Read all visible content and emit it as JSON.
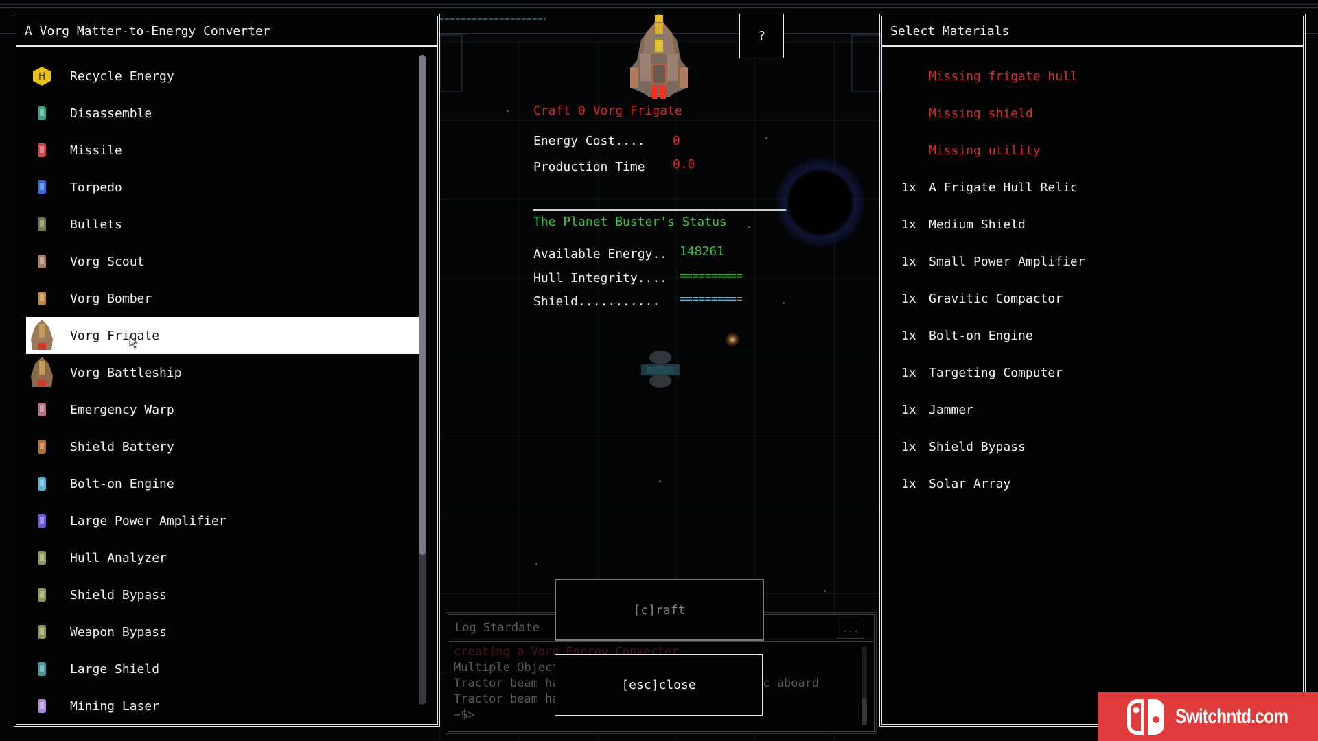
{
  "converter": {
    "title": "A Vorg Matter-to-Energy Converter",
    "items": [
      {
        "label": "Recycle Energy",
        "icon": "recycle-energy-icon",
        "color": "#e8c21a"
      },
      {
        "label": "Disassemble",
        "icon": "disassemble-icon",
        "color": "#3aa38a"
      },
      {
        "label": "Missile",
        "icon": "missile-icon",
        "color": "#c84a4a"
      },
      {
        "label": "Torpedo",
        "icon": "torpedo-icon",
        "color": "#3a6ad8"
      },
      {
        "label": "Bullets",
        "icon": "bullets-icon",
        "color": "#6f7a4a"
      },
      {
        "label": "Vorg Scout",
        "icon": "vorg-scout-icon",
        "color": "#a08060"
      },
      {
        "label": "Vorg Bomber",
        "icon": "vorg-bomber-icon",
        "color": "#b58a3a"
      },
      {
        "label": "Vorg Frigate",
        "icon": "vorg-frigate-icon",
        "color": "#9a7a5a",
        "selected": true
      },
      {
        "label": "Vorg Battleship",
        "icon": "vorg-battleship-icon",
        "color": "#8a6a4a"
      },
      {
        "label": "Emergency Warp",
        "icon": "emergency-warp-icon",
        "color": "#b07080"
      },
      {
        "label": "Shield Battery",
        "icon": "shield-battery-icon",
        "color": "#b0703a"
      },
      {
        "label": "Bolt-on Engine",
        "icon": "bolt-on-engine-icon",
        "color": "#5ab0d0"
      },
      {
        "label": "Large Power Amplifier",
        "icon": "large-power-amplifier-icon",
        "color": "#6a5ad8"
      },
      {
        "label": "Hull Analyzer",
        "icon": "hull-analyzer-icon",
        "color": "#8a9a5a"
      },
      {
        "label": "Shield Bypass",
        "icon": "shield-bypass-icon",
        "color": "#8a9a5a"
      },
      {
        "label": "Weapon Bypass",
        "icon": "weapon-bypass-icon",
        "color": "#8a9a5a"
      },
      {
        "label": "Large Shield",
        "icon": "large-shield-icon",
        "color": "#4a9a9a"
      },
      {
        "label": "Mining Laser",
        "icon": "mining-laser-icon",
        "color": "#b08ad0"
      }
    ],
    "scroll_fraction_visible": 0.77,
    "scroll_position": 0
  },
  "help_button": {
    "label": "?"
  },
  "craft": {
    "title": "Craft 0 Vorg Frigate",
    "energy_cost_label": "Energy Cost....",
    "energy_cost_value": "0",
    "production_time_label": "Production Time",
    "production_time_value": "0.0"
  },
  "status": {
    "title": "The Planet Buster's Status",
    "available_energy_label": "Available Energy..",
    "available_energy_value": "148261",
    "hull_label": "Hull Integrity....",
    "hull_segments": 10,
    "hull_filled": 10,
    "shield_label": "Shield...........",
    "shield_segments": 10,
    "shield_filled": 9
  },
  "buttons": {
    "craft": "[c]raft",
    "close": "[esc]close"
  },
  "log": {
    "title": "Log Stardate",
    "more": "...",
    "lines": [
      {
        "text": "creating a Vorg Energy Converter",
        "type": "error"
      },
      {
        "text": "Multiple Objects Detected",
        "type": "normal"
      },
      {
        "text": "Tractor beam has brought A Frigate Hull Relic aboard",
        "type": "normal"
      },
      {
        "text": "Tractor beam has brought Uranium aboard",
        "type": "normal"
      },
      {
        "text": "~$>",
        "type": "prompt"
      }
    ]
  },
  "materials": {
    "title": "Select Materials",
    "missing": [
      "Missing frigate hull",
      "Missing shield",
      "Missing utility"
    ],
    "items": [
      {
        "qty": "1x",
        "name": "A Frigate Hull Relic"
      },
      {
        "qty": "1x",
        "name": "Medium Shield"
      },
      {
        "qty": "1x",
        "name": "Small Power Amplifier"
      },
      {
        "qty": "1x",
        "name": "Gravitic Compactor"
      },
      {
        "qty": "1x",
        "name": "Bolt-on Engine"
      },
      {
        "qty": "1x",
        "name": "Targeting Computer"
      },
      {
        "qty": "1x",
        "name": "Jammer"
      },
      {
        "qty": "1x",
        "name": "Shield Bypass"
      },
      {
        "qty": "1x",
        "name": "Solar Array"
      }
    ]
  },
  "colors": {
    "missing": "#d72a2a",
    "status_title": "#3ec43e",
    "hull_bar": "#3ec43e",
    "shield_bar": "#4ec0e0",
    "bar_empty": "#8a8a8a",
    "selected_row": "#ffffff"
  },
  "watermark": {
    "text": "Switchntd.com"
  }
}
